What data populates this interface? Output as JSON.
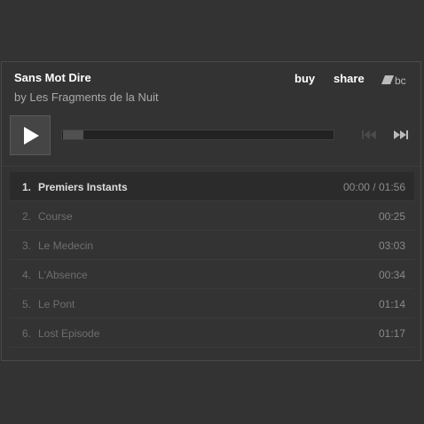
{
  "album": {
    "title": "Sans Mot Dire",
    "byline": "by Les Fragments de la Nuit"
  },
  "header": {
    "buy_label": "buy",
    "share_label": "share",
    "logo_text": "bc"
  },
  "player": {
    "progress_fraction": 0.0
  },
  "tracks": [
    {
      "num": "1.",
      "title": "Premiers Instants",
      "duration": "00:00 / 01:56"
    },
    {
      "num": "2.",
      "title": "Course",
      "duration": "00:25"
    },
    {
      "num": "3.",
      "title": "Le Medecin",
      "duration": "03:03"
    },
    {
      "num": "4.",
      "title": "L'Absence",
      "duration": "00:34"
    },
    {
      "num": "5.",
      "title": "Le Pont",
      "duration": "01:14"
    },
    {
      "num": "6.",
      "title": "Lost Episode",
      "duration": "01:17"
    }
  ],
  "colors": {
    "background": "#333333",
    "title_text": "#ffffff",
    "muted_text": "#aaaaaa"
  }
}
